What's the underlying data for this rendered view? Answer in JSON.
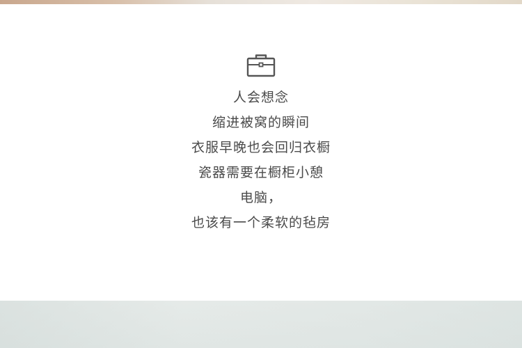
{
  "icons": {
    "section_icon": "briefcase-icon"
  },
  "colors": {
    "text": "#4a4a4a",
    "icon_stroke": "#555555",
    "background": "#ffffff"
  },
  "poem": {
    "lines": [
      "人会想念",
      "缩进被窝的瞬间",
      "衣服早晚也会回归衣橱",
      "瓷器需要在橱柜小憩",
      "电脑，",
      "也该有一个柔软的毡房"
    ]
  }
}
